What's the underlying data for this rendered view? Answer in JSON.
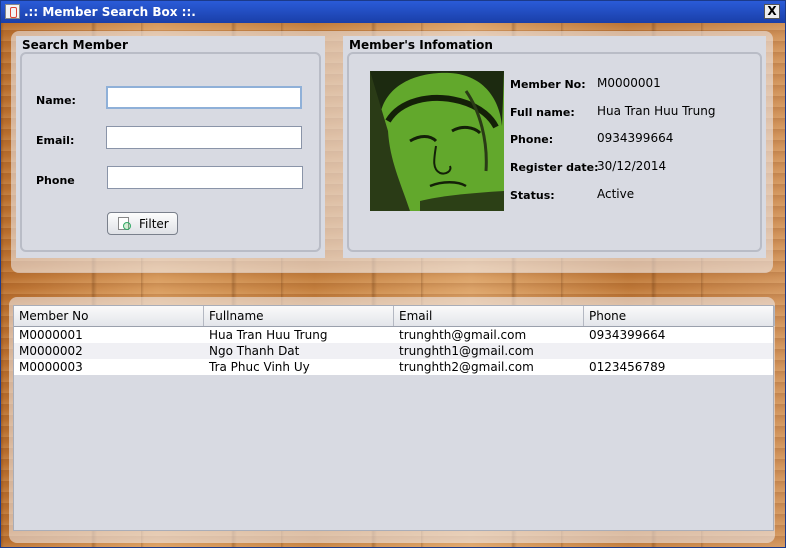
{
  "window": {
    "title": ".:: Member Search Box ::.",
    "close_label": "X"
  },
  "search": {
    "title": "Search Member",
    "name_label": "Name:",
    "email_label": "Email:",
    "phone_label": "Phone",
    "name_value": "",
    "email_value": "",
    "phone_value": "",
    "filter_label": "Filter"
  },
  "info": {
    "title": "Member's Infomation",
    "member_no_label": "Member No:",
    "member_no": "M0000001",
    "fullname_label": "Full name:",
    "fullname": "Hua Tran Huu Trung",
    "phone_label": "Phone:",
    "phone": "0934399664",
    "register_label": "Register date:",
    "register_date": "30/12/2014",
    "status_label": "Status:",
    "status": "Active"
  },
  "table": {
    "columns": [
      "Member No",
      "Fullname",
      "Email",
      "Phone"
    ],
    "rows": [
      [
        "M0000001",
        "Hua Tran Huu Trung",
        "trunghth@gmail.com",
        "0934399664"
      ],
      [
        "M0000002",
        "Ngo Thanh Dat",
        "trunghth1@gmail.com",
        ""
      ],
      [
        "M0000003",
        "Tra Phuc Vinh Uy",
        "trunghth2@gmail.com",
        "0123456789"
      ]
    ]
  }
}
